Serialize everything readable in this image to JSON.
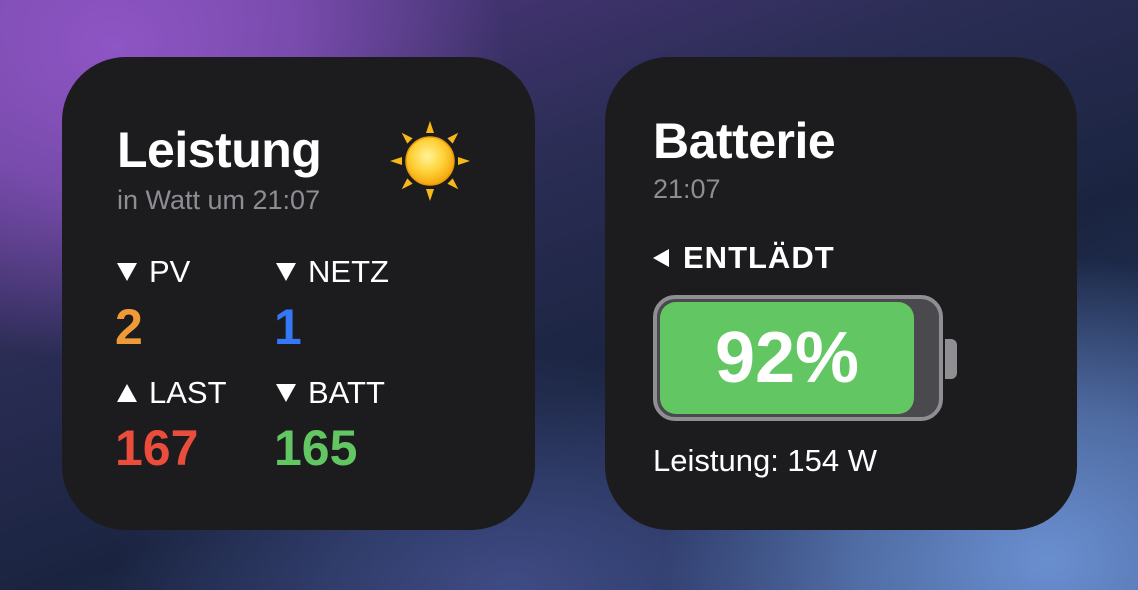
{
  "power_widget": {
    "title": "Leistung",
    "subtitle": "in Watt um 21:07",
    "weather_icon": "sun-icon",
    "metrics": [
      {
        "label": "PV",
        "direction": "down",
        "value": "2",
        "color": "#f09a37"
      },
      {
        "label": "NETZ",
        "direction": "down",
        "value": "1",
        "color": "#3478f6"
      },
      {
        "label": "LAST",
        "direction": "up",
        "value": "167",
        "color": "#eb4d3d"
      },
      {
        "label": "BATT",
        "direction": "down",
        "value": "165",
        "color": "#62c763"
      }
    ]
  },
  "battery_widget": {
    "title": "Batterie",
    "subtitle": "21:07",
    "status": "ENTLÄDT",
    "status_icon": "left-arrow-icon",
    "percent_text": "92%",
    "level": 0.92,
    "power_text": "Leistung: 154 W",
    "fill_color": "#62c763"
  }
}
